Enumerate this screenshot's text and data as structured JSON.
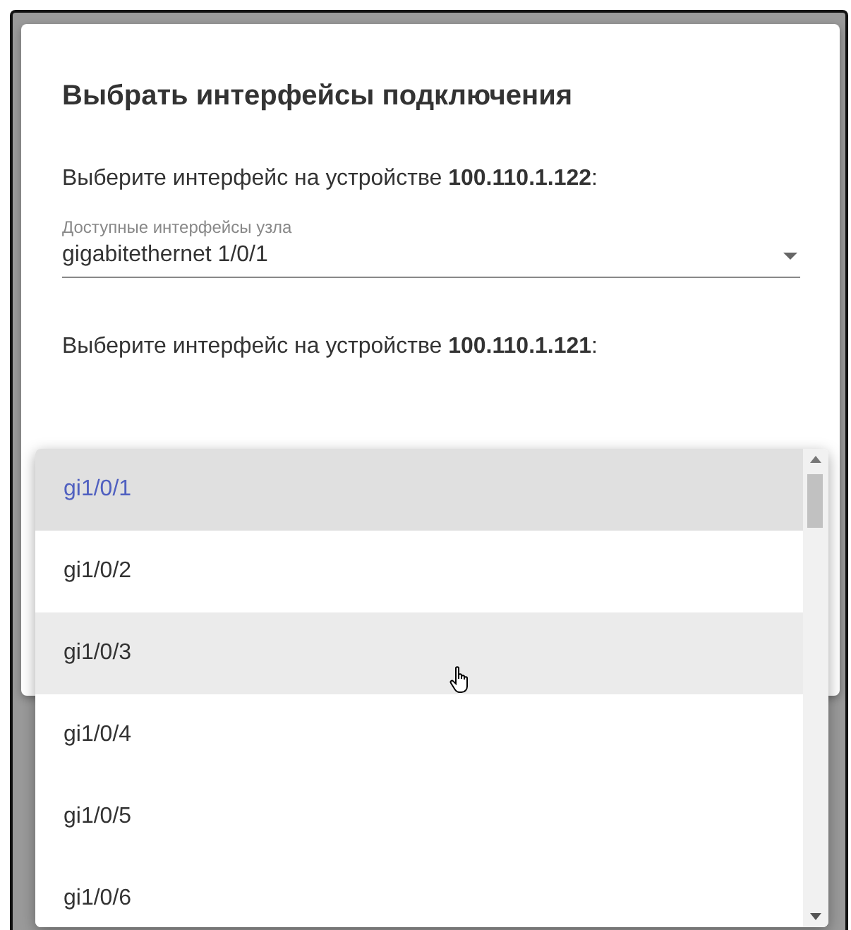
{
  "dialog": {
    "title": "Выбрать интерфейсы подключения",
    "sections": [
      {
        "prompt": "Выберите интерфейс на устройстве **100.110.1.122**:",
        "field": {
          "label": "Доступные интерфейсы узла",
          "value": "gigabitethernet 1/0/1"
        }
      },
      {
        "prompt": "Выберите интерфейс на устройстве **100.110.1.121**:"
      }
    ]
  },
  "menu": {
    "items": [
      {
        "label": "gi1/0/1",
        "selected": true,
        "hovered": false
      },
      {
        "label": "gi1/0/2",
        "selected": false,
        "hovered": false
      },
      {
        "label": "gi1/0/3",
        "selected": false,
        "hovered": true
      },
      {
        "label": "gi1/0/4",
        "selected": false,
        "hovered": false
      },
      {
        "label": "gi1/0/5",
        "selected": false,
        "hovered": false
      },
      {
        "label": "gi1/0/6",
        "selected": false,
        "hovered": false
      }
    ]
  }
}
